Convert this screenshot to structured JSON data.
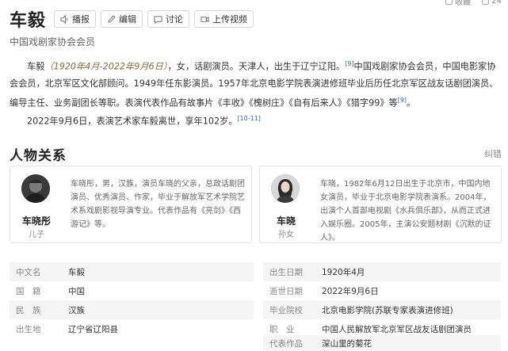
{
  "top_bar": {
    "collect": "收藏",
    "like_count": "24"
  },
  "header": {
    "title": "车毅",
    "actions": [
      {
        "label": "播报",
        "icon": "speaker-icon"
      },
      {
        "label": "编辑",
        "icon": "edit-icon"
      },
      {
        "label": "讨论",
        "icon": "chat-icon"
      },
      {
        "label": "上传视频",
        "icon": "video-icon"
      }
    ]
  },
  "subtitle": "中国戏剧家协会会员",
  "summary": {
    "name": "车毅",
    "dates": "（1920年4月-2022年9月6日）",
    "text1": "，女，话剧演员。天津人，出生于辽宁辽阳。",
    "ref1": "[9]",
    "text2": "中国戏剧家协会会员，中国电影家协会会员，北京军区文化部顾问。1949年任东影演员。1957年北京电影学院表演进修班毕业后历任北京军区战友话剧团演员、编导主任、业务副团长等职。表演代表作品有故事片《丰收》《槐树庄》《自有后来人》《猎字99》等",
    "ref2": "[9]",
    "text3": "。",
    "text4": "2022年9月6日，表演艺术家车毅离世，享年102岁。",
    "ref3": "[10-11]"
  },
  "relations": {
    "section_title": "人物关系",
    "correct_label": "纠错",
    "people": [
      {
        "name": "车晓彤",
        "relation": "儿子",
        "desc": "车晓彤，男，汉族，演员车晓的父亲，总政话剧团演员、优秀演员、作家，毕业于解放军艺术学院艺术系戏剧影视导演专业。代表作品有《亮剑》《西游记》等。"
      },
      {
        "name": "车晓",
        "relation": "孙女",
        "desc": "车晓，1982年6月12日出生于北京市，中国内地女演员，毕业于北京电影学院表演系。2004年，出演个人首部电视剧《水兵俱乐部》，从而正式进入娱乐圈。2005年，主演公安题材剧《沉默的证人》。"
      }
    ]
  },
  "info": {
    "left": [
      {
        "label": "中文名",
        "value": "车毅"
      },
      {
        "label": "国　籍",
        "value": "中国"
      },
      {
        "label": "民　族",
        "value": "汉族"
      },
      {
        "label": "出生地",
        "value": "辽宁省辽阳县"
      }
    ],
    "right": [
      {
        "label": "出生日期",
        "value": "1920年4月"
      },
      {
        "label": "逝世日期",
        "value": "2022年9月6日"
      },
      {
        "label": "毕业院校",
        "value": "北京电影学院(苏联专家表演进修班)"
      },
      {
        "label": "职　业",
        "value": "中国人民解放军北京军区战友话剧团演员"
      },
      {
        "label": "代表作品",
        "value": "深山里的菊花"
      }
    ]
  }
}
